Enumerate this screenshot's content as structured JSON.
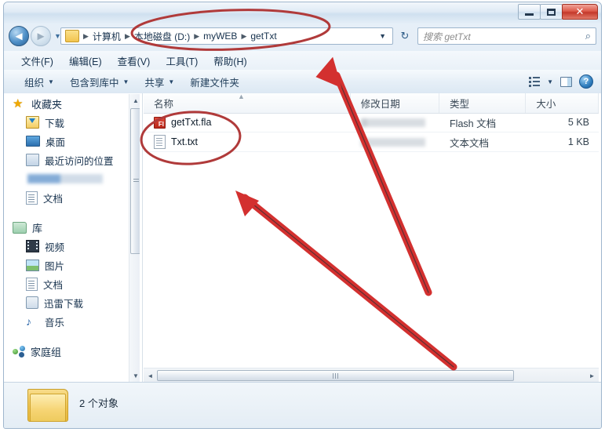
{
  "window": {
    "buttons": {
      "minimize": "minimize-button",
      "maximize": "maximize-button",
      "close": "✕"
    }
  },
  "addressbar": {
    "back_glyph": "◄",
    "forward_glyph": "►",
    "dropdown_glyph": "▼",
    "crumbs": [
      "计算机",
      "本地磁盘 (D:)",
      "myWEB",
      "getTxt"
    ],
    "separator": "▶",
    "caret": "▼",
    "refresh_glyph": "↻"
  },
  "search": {
    "placeholder": "搜索 getTxt",
    "icon_glyph": "⌕"
  },
  "menu": {
    "items": [
      "文件(F)",
      "编辑(E)",
      "查看(V)",
      "工具(T)",
      "帮助(H)"
    ]
  },
  "toolbar": {
    "items": [
      {
        "label": "组织",
        "caret": "▼"
      },
      {
        "label": "包含到库中",
        "caret": "▼"
      },
      {
        "label": "共享",
        "caret": "▼"
      },
      {
        "label": "新建文件夹",
        "caret": ""
      }
    ],
    "view_caret": "▼",
    "help_glyph": "?"
  },
  "sidebar": {
    "groups": [
      {
        "root": {
          "label": "收藏夹",
          "icon": "star-icon"
        },
        "items": [
          {
            "label": "下载",
            "icon": "download-icon"
          },
          {
            "label": "桌面",
            "icon": "desktop-icon"
          },
          {
            "label": "最近访问的位置",
            "icon": "recent-places-icon"
          },
          {
            "label": "",
            "icon": "blurred-item",
            "blurred": true
          },
          {
            "label": "文档",
            "icon": "document-icon"
          }
        ]
      },
      {
        "root": {
          "label": "库",
          "icon": "library-folder-icon"
        },
        "items": [
          {
            "label": "视频",
            "icon": "video-icon"
          },
          {
            "label": "图片",
            "icon": "picture-icon"
          },
          {
            "label": "文档",
            "icon": "document-icon"
          },
          {
            "label": "迅雷下载",
            "icon": "thunder-download-icon"
          },
          {
            "label": "音乐",
            "icon": "music-note-icon"
          }
        ]
      },
      {
        "root": {
          "label": "家庭组",
          "icon": "homegroup-icon"
        },
        "items": []
      }
    ]
  },
  "filelist": {
    "columns": [
      "名称",
      "修改日期",
      "类型",
      "大小"
    ],
    "sort_indicator": "▲",
    "rows": [
      {
        "name": "getTxt.fla",
        "icon": "flash-file-icon",
        "icon_text": "Fl",
        "date": "",
        "type": "Flash 文档",
        "size": "5 KB"
      },
      {
        "name": "Txt.txt",
        "icon": "text-file-icon",
        "icon_text": "",
        "date": "",
        "type": "文本文档",
        "size": "1 KB"
      }
    ],
    "scroll_left_glyph": "◄",
    "scroll_right_glyph": "►"
  },
  "statusbar": {
    "text": "2 个对象"
  },
  "annotations": {
    "color": "#d3302f",
    "ellipse_color": "#b03a3a",
    "shapes": [
      {
        "type": "ellipse",
        "name": "address-path-highlight"
      },
      {
        "type": "ellipse",
        "name": "file-rows-highlight"
      },
      {
        "type": "arrow",
        "name": "arrow-to-address-path"
      },
      {
        "type": "arrow",
        "name": "arrow-to-file-rows"
      }
    ]
  },
  "colors": {
    "accent": "#2f7dbd",
    "annotation_red": "#d3302f",
    "close_red": "#c4382a"
  }
}
